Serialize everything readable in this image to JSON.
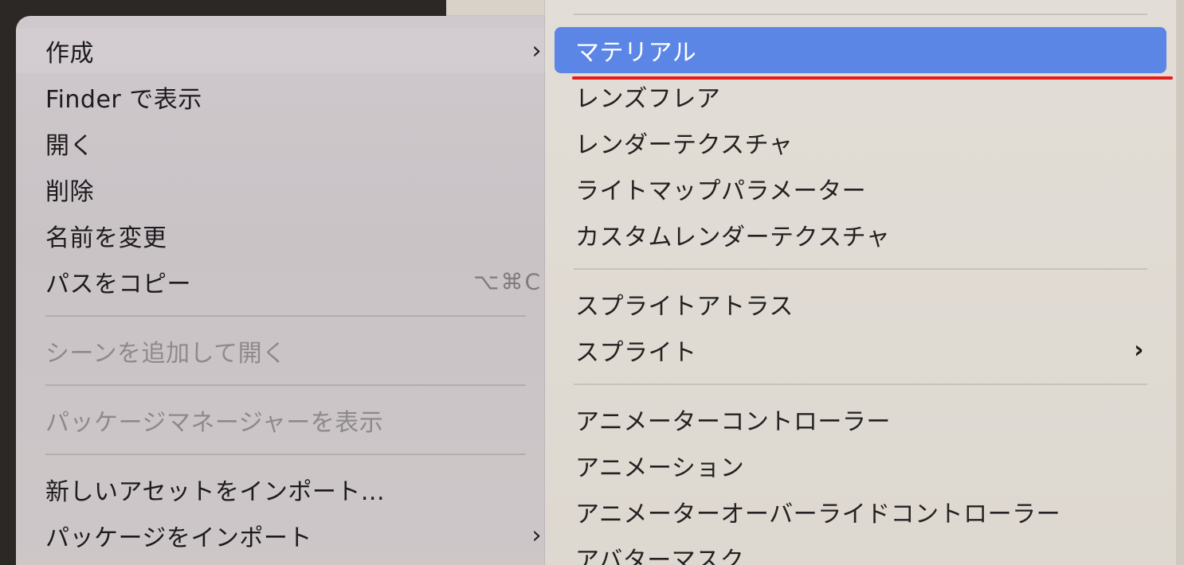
{
  "left_menu": {
    "items": [
      {
        "label": "作成",
        "has_submenu": true
      },
      {
        "label": "Finder で表示"
      },
      {
        "label": "開く"
      },
      {
        "label": "削除"
      },
      {
        "label": "名前を変更"
      },
      {
        "label": "パスをコピー",
        "shortcut": "⌥⌘C"
      },
      {
        "label": "シーンを追加して開く",
        "disabled": true
      },
      {
        "label": "パッケージマネージャーを表示",
        "disabled": true
      },
      {
        "label": "新しいアセットをインポート..."
      },
      {
        "label": "パッケージをインポート",
        "has_submenu": true
      }
    ],
    "chevron": "›"
  },
  "right_menu": {
    "items": [
      {
        "label": "マテリアル",
        "highlighted": true
      },
      {
        "label": "レンズフレア"
      },
      {
        "label": "レンダーテクスチャ"
      },
      {
        "label": "ライトマップパラメーター"
      },
      {
        "label": "カスタムレンダーテクスチャ"
      },
      {
        "label": "スプライトアトラス"
      },
      {
        "label": "スプライト",
        "has_submenu": true
      },
      {
        "label": "アニメーターコントローラー"
      },
      {
        "label": "アニメーション"
      },
      {
        "label": "アニメーターオーバーライドコントローラー"
      },
      {
        "label": "アバターマスク"
      }
    ],
    "chevron": "›"
  },
  "colors": {
    "highlight": "#5b86e6",
    "annotation_underline": "#e41c1c"
  }
}
